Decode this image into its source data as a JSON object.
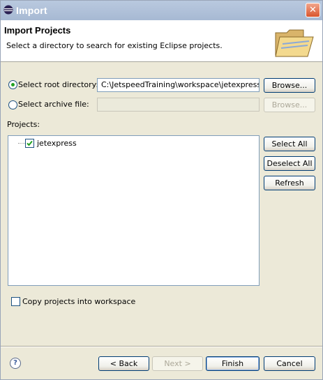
{
  "window": {
    "title": "Import",
    "close_glyph": "✕"
  },
  "banner": {
    "heading": "Import Projects",
    "description": "Select a directory to search for existing Eclipse projects.",
    "icon": "folder-icon"
  },
  "source": {
    "root_label": "Select root directory:",
    "root_value": "C:\\JetspeedTraining\\workspace\\jetexpress",
    "root_selected": true,
    "archive_label": "Select archive file:",
    "archive_value": "",
    "archive_selected": false,
    "browse_label": "Browse..."
  },
  "projects": {
    "label": "Projects:",
    "items": [
      {
        "name": "jetexpress",
        "checked": true
      }
    ],
    "select_all": "Select All",
    "deselect_all": "Deselect All",
    "refresh": "Refresh"
  },
  "options": {
    "copy_label": "Copy projects into workspace",
    "copy_checked": false
  },
  "footer": {
    "help_glyph": "?",
    "back": "< Back",
    "next": "Next >",
    "finish": "Finish",
    "cancel": "Cancel"
  },
  "colors": {
    "title_bar": "#a7b9d3",
    "dialog_bg": "#ece9d8",
    "radio_dot": "#21a121",
    "close_button": "#d9552e"
  }
}
